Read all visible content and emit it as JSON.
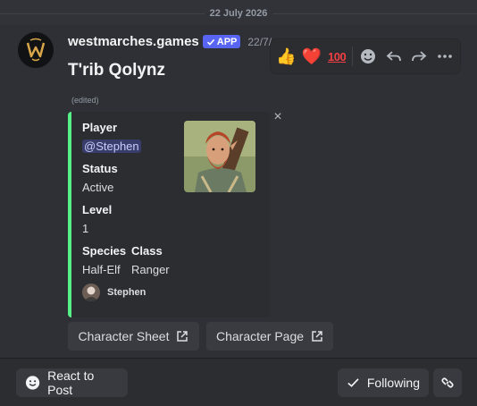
{
  "date_divider": "22 July 2026",
  "message": {
    "username": "westmarches.games",
    "app_badge": "APP",
    "timestamp": "22/7/",
    "title": "T'rib Qolynz",
    "edited": "(edited)"
  },
  "embed": {
    "accent_color": "#57f287",
    "fields": {
      "player": {
        "name": "Player",
        "value": "@Stephen"
      },
      "status": {
        "name": "Status",
        "value": "Active"
      },
      "level": {
        "name": "Level",
        "value": "1"
      },
      "species": {
        "name": "Species",
        "value": "Half-Elf"
      },
      "class": {
        "name": "Class",
        "value": "Ranger"
      }
    },
    "footer": "Stephen"
  },
  "buttons": {
    "character_sheet": "Character Sheet",
    "character_page": "Character Page"
  },
  "toolbar": {
    "reactions": [
      "👍",
      "❤️",
      "100"
    ],
    "icons": [
      "add-reaction-icon",
      "reply-icon",
      "forward-icon",
      "more-icon"
    ]
  },
  "bottom_bar": {
    "react": "React to Post",
    "following": "Following"
  }
}
